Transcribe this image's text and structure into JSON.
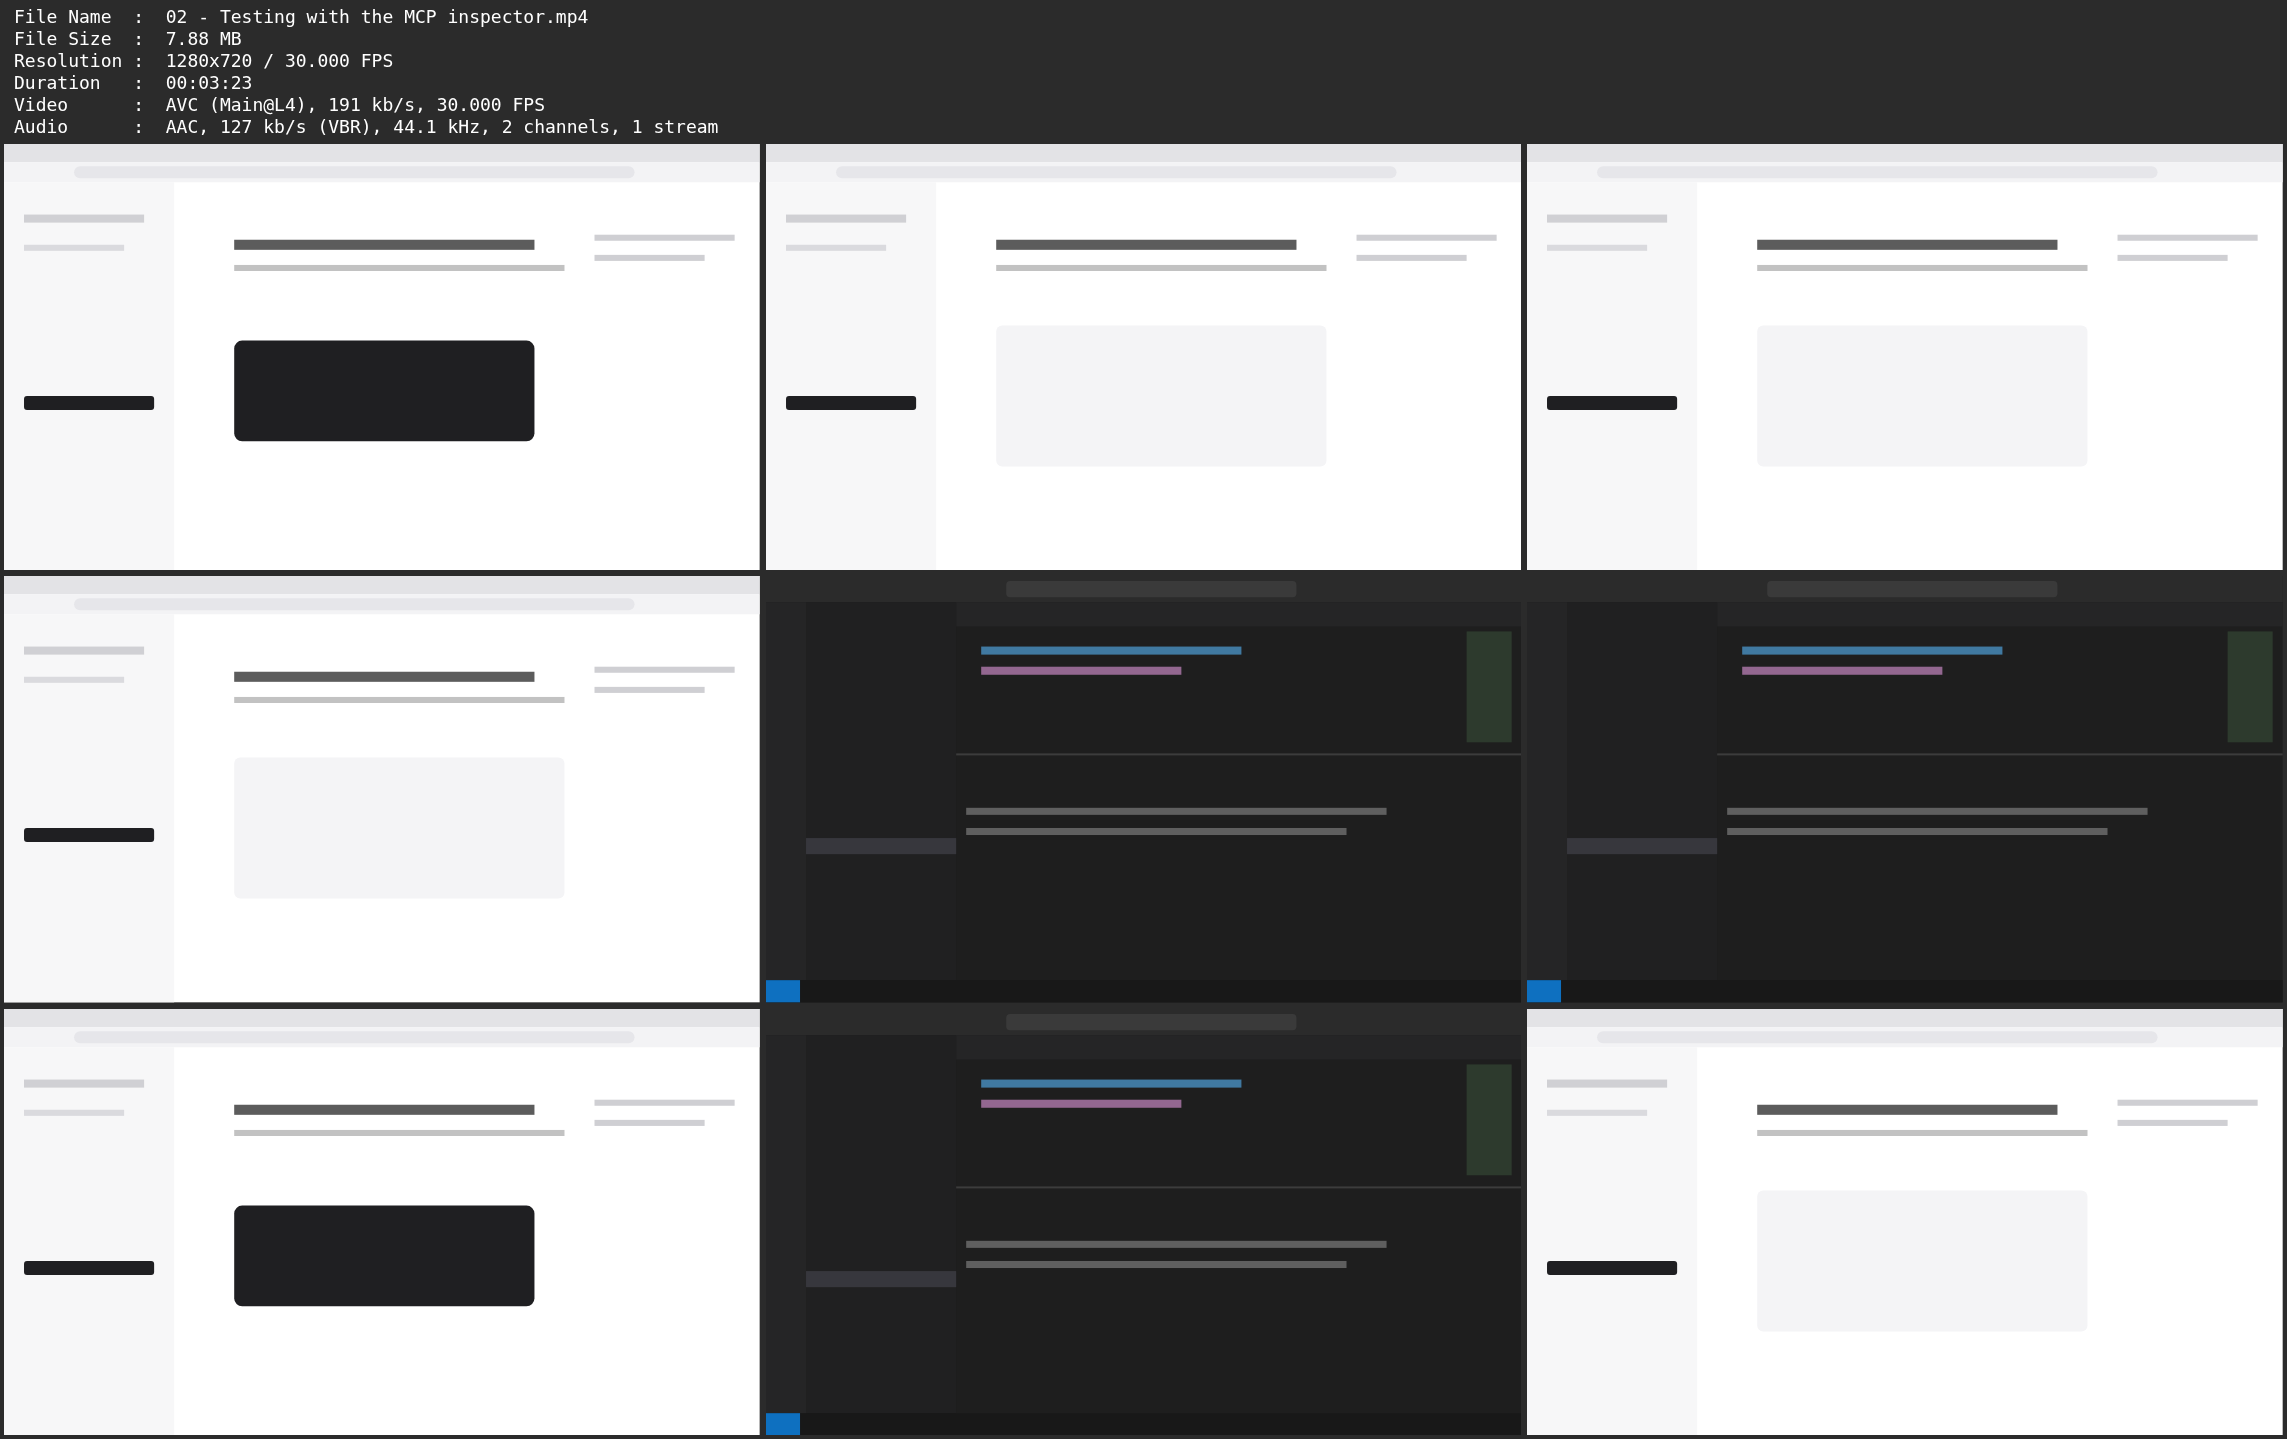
{
  "file_info": [
    "File Name  :  02 - Testing with the MCP inspector.mp4",
    "File Size  :  7.88 MB",
    "Resolution :  1280x720 / 30.000 FPS",
    "Duration   :  00:03:23",
    "Video      :  AVC (Main@L4), 191 kb/s, 30.000 FPS",
    "Audio      :  AAC, 127 kb/s (VBR), 44.1 kHz, 2 channels, 1 stream"
  ]
}
